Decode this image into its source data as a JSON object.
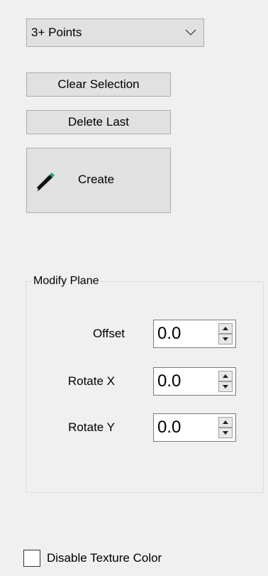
{
  "mode_select": {
    "selected": "3+ Points"
  },
  "buttons": {
    "clear_selection": "Clear Selection",
    "delete_last": "Delete Last",
    "create": "Create"
  },
  "modify_plane": {
    "title": "Modify Plane",
    "fields": [
      {
        "label": "Offset",
        "value": "0.0"
      },
      {
        "label": "Rotate X",
        "value": "0.0"
      },
      {
        "label": "Rotate Y",
        "value": "0.0"
      }
    ]
  },
  "disable_texture_color": {
    "label": "Disable Texture Color",
    "checked": false
  },
  "icons": {
    "dropdown": "chevron-down-icon",
    "create": "pencil-icon",
    "spin": "spin-arrows-icon"
  },
  "colors": {
    "background": "#f0f0f0",
    "button_face": "#e1e1e1",
    "pencil_tip": "#17a589"
  }
}
